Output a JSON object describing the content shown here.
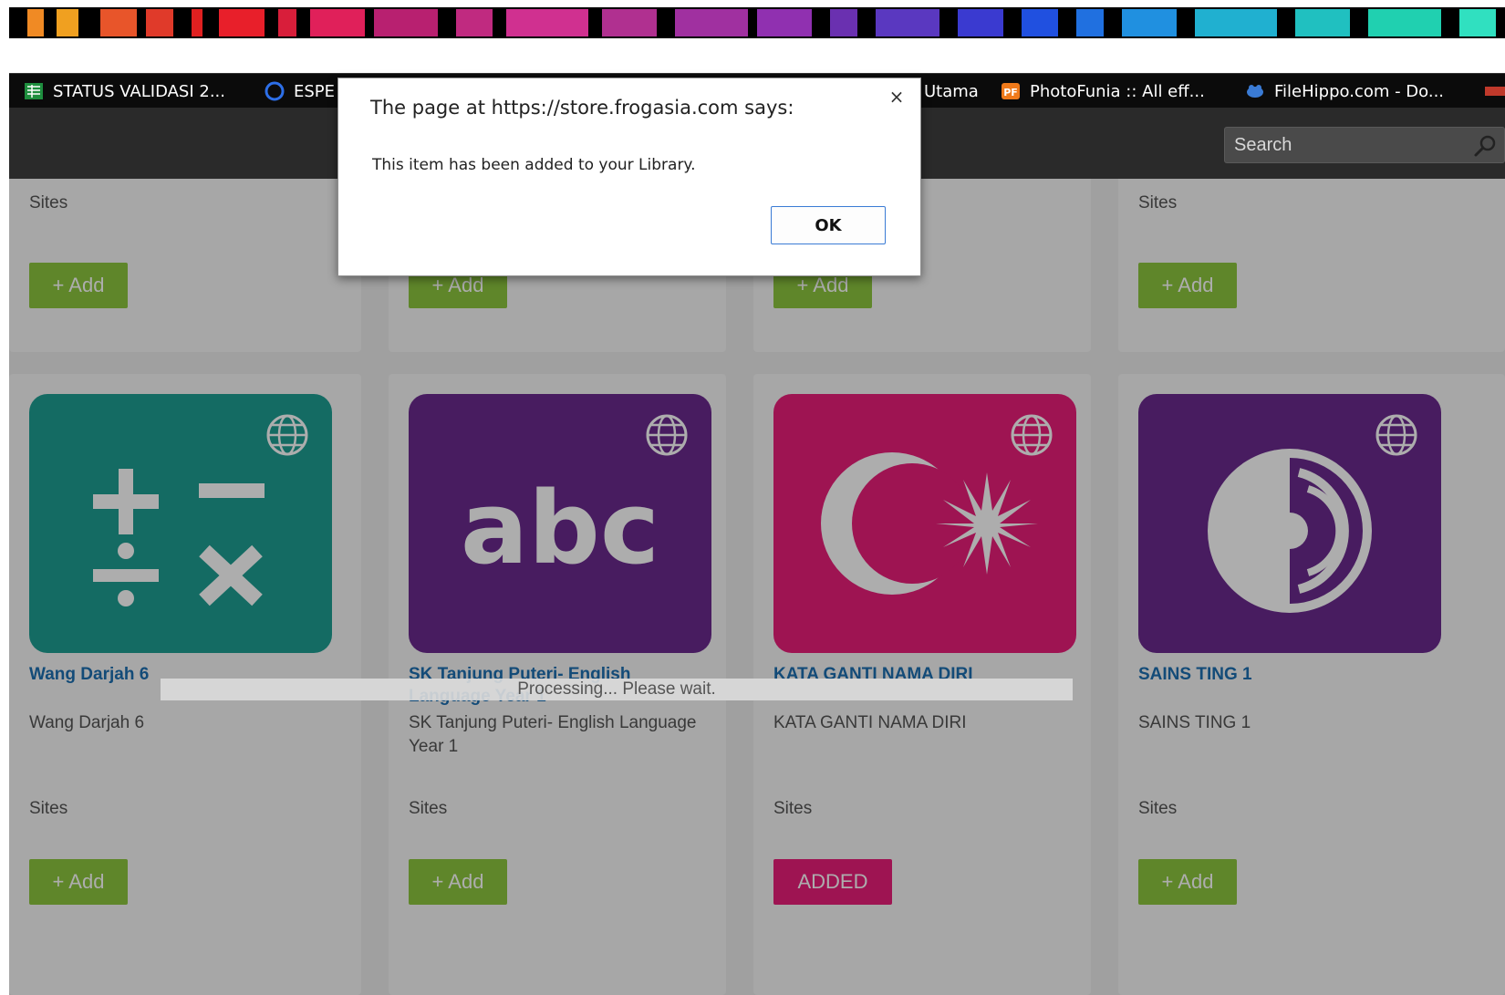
{
  "bookmarks": [
    {
      "label": "STATUS VALIDASI 2...",
      "icon": "spreadsheet-icon"
    },
    {
      "label": "ESPE",
      "icon": "ring-icon"
    },
    {
      "label": "Utama",
      "icon": ""
    },
    {
      "label": "PhotoFunia :: All eff...",
      "icon": "photofunia-icon"
    },
    {
      "label": "FileHippo.com - Do...",
      "icon": "filehippo-icon"
    }
  ],
  "header": {
    "search_placeholder": "Search"
  },
  "top_row": [
    {
      "category": "Sites",
      "add_label": "+ Add"
    },
    {
      "category": "",
      "add_label": "+ Add"
    },
    {
      "category": "",
      "add_label": "+ Add"
    },
    {
      "category": "Sites",
      "add_label": "+ Add"
    }
  ],
  "apps": [
    {
      "title": "Wang Darjah 6",
      "description": "Wang Darjah 6",
      "category": "Sites",
      "button_label": "+ Add",
      "tile_color": "#1e9e93",
      "icon": "math-operators-icon"
    },
    {
      "title": "SK Tanjung Puteri- English Language Year 1",
      "description": "SK Tanjung Puteri- English Language Year 1",
      "category": "Sites",
      "button_label": "+ Add",
      "tile_color": "#6a2a8e",
      "icon": "abc-icon"
    },
    {
      "title": "KATA GANTI NAMA DIRI",
      "description": "KATA GANTI NAMA DIRI",
      "category": "Sites",
      "button_label": "ADDED",
      "tile_color": "#e91e7a",
      "icon": "crescent-star-icon"
    },
    {
      "title": "SAINS TING 1",
      "description": "SAINS TING 1",
      "category": "Sites",
      "button_label": "+ Add",
      "tile_color": "#6a2a8e",
      "icon": "science-icon"
    }
  ],
  "tile_glyph_abc": "abc",
  "processing_text": "Processing... Please wait.",
  "dialog": {
    "title": "The page at https://store.frogasia.com says:",
    "message": "This item has been added to your Library.",
    "ok_label": "OK",
    "close_glyph": "×"
  },
  "colors": {
    "add_green": "#8cc63e",
    "added_pink": "#e91e7a",
    "link_blue": "#1d6fb1"
  }
}
